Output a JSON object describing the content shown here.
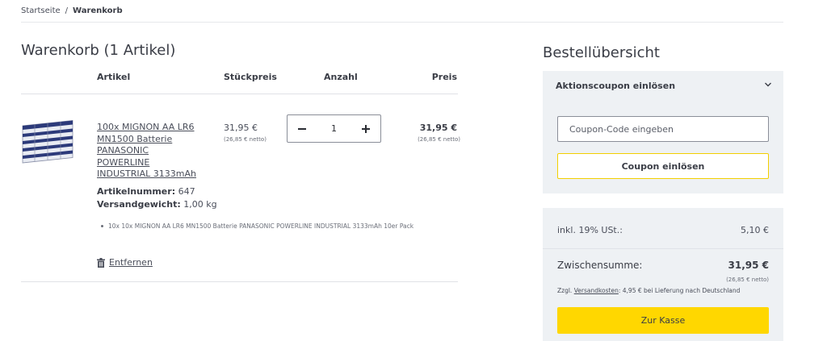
{
  "breadcrumb": {
    "home": "Startseite",
    "separator": "/",
    "current": "Warenkorb"
  },
  "cart": {
    "title": "Warenkorb (1 Artikel)",
    "columns": {
      "article": "Artikel",
      "unit_price": "Stückpreis",
      "quantity": "Anzahl",
      "price": "Preis"
    },
    "item": {
      "name": "100x MIGNON AA LR6 MN1500 Batterie PANASONIC POWERLINE INDUSTRIAL 3133mAh",
      "article_number_label": "Artikelnummer:",
      "article_number": "647",
      "weight_label": "Versandgewicht:",
      "weight": "1,00 kg",
      "bundle_line": "10x 10x MIGNON AA LR6 MN1500 Batterie PANASONIC POWERLINE INDUSTRIAL 3133mAh 10er Pack",
      "unit_price": "31,95 €",
      "unit_price_net": "(26,85 € netto)",
      "quantity": "1",
      "price": "31,95 €",
      "price_net": "(26,85 € netto)",
      "remove_label": "Entfernen"
    }
  },
  "summary": {
    "title": "Bestellübersicht",
    "coupon": {
      "heading": "Aktionscoupon einlösen",
      "placeholder": "Coupon-Code eingeben",
      "button": "Coupon einlösen"
    },
    "totals": {
      "vat_label": "inkl. 19% USt.:",
      "vat_value": "5,10 €",
      "subtotal_label": "Zwischensumme:",
      "subtotal_value": "31,95 €",
      "subtotal_net": "(26,85 € netto)",
      "shipping_prefix": "Zzgl.",
      "shipping_link": "Versandkosten",
      "shipping_suffix": ": 4,95 € bei Lieferung nach Deutschland",
      "checkout_button": "Zur Kasse"
    }
  },
  "colors": {
    "accent_yellow": "#ffd700",
    "panel_bg": "#eef1f4",
    "text": "#3a3d46"
  },
  "icons": {
    "minus": "minus-icon",
    "plus": "plus-icon",
    "trash": "trash-icon",
    "chevron": "chevron-down-icon"
  }
}
